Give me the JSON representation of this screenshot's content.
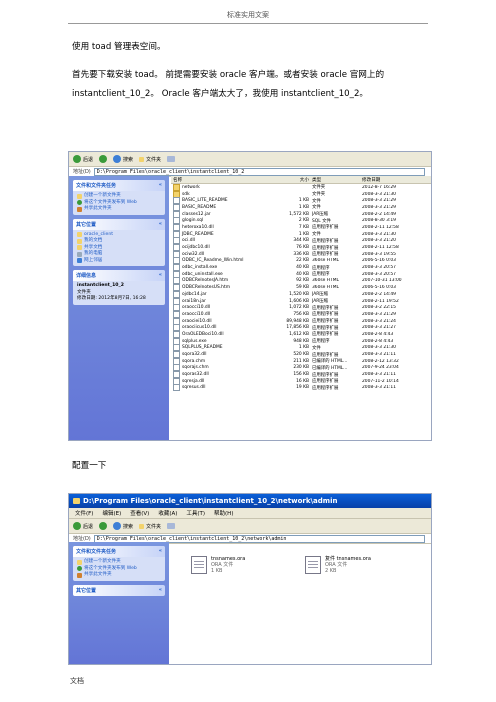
{
  "header": {
    "text": "标准实用文案"
  },
  "paragraphs": [
    "使用 toad 管理表空间。",
    "首先要下载安装 toad。 前提需要安装 oracle 客户端。或者安装 oracle 官网上的 instantclient_10_2。 Oracle 客户端太大了，我使用 instantclient_10_2。"
  ],
  "config_label": "配置一下",
  "footer": {
    "text": "文档"
  },
  "window1": {
    "toolbar": {
      "back": "后退",
      "search": "搜索",
      "folders": "文件夹"
    },
    "address_label": "地址(D)",
    "address": "D:\\Program Files\\oracle_client\\instantclient_10_2",
    "panel_tasks": {
      "title": "文件和文件夹任务",
      "items": [
        "创建一个新文件夹",
        "将这个文件夹发布到 Web",
        "共享此文件夹"
      ]
    },
    "panel_places": {
      "title": "其它位置",
      "items": [
        "oracle_client",
        "我的文档",
        "共享文档",
        "我的电脑",
        "网上邻居"
      ]
    },
    "panel_details": {
      "title": "详细信息",
      "name": "instantclient_10_2",
      "type": "文件夹",
      "modified": "修改日期: 2012年8月7日, 16:28"
    },
    "columns": [
      "名称",
      "大小",
      "类型",
      "修改日期"
    ],
    "files": [
      {
        "name": "network",
        "size": "",
        "type": "文件夹",
        "date": "2012-8-7 16:29",
        "folder": true
      },
      {
        "name": "sdk",
        "size": "",
        "type": "文件夹",
        "date": "2008-3-3 21:30",
        "folder": true
      },
      {
        "name": "BASIC_LITE_README",
        "size": "1 KB",
        "type": "文件",
        "date": "2008-3-3 21:29"
      },
      {
        "name": "BASIC_README",
        "size": "1 KB",
        "type": "文件",
        "date": "2008-3-3 21:29"
      },
      {
        "name": "classes12.jar",
        "size": "1,572 KB",
        "type": "JAR压缩",
        "date": "2008-2-2 14:49"
      },
      {
        "name": "glogin.sql",
        "size": "2 KB",
        "type": "SQL 文件",
        "date": "2008-8-30 3:19"
      },
      {
        "name": "heteroxa10.dll",
        "size": "7 KB",
        "type": "应用程序扩展",
        "date": "2008-2-11 12:58"
      },
      {
        "name": "JDBC_README",
        "size": "1 KB",
        "type": "文件",
        "date": "2008-3-3 21:30"
      },
      {
        "name": "oci.dll",
        "size": "344 KB",
        "type": "应用程序扩展",
        "date": "2008-3-3 21:20"
      },
      {
        "name": "ocijdbc10.dll",
        "size": "76 KB",
        "type": "应用程序扩展",
        "date": "2008-2-11 12:58"
      },
      {
        "name": "ociw32.dll",
        "size": "336 KB",
        "type": "应用程序扩展",
        "date": "2008-3-3 19:55"
      },
      {
        "name": "ODBC_IC_Readme_Win.html",
        "size": "22 KB",
        "type": "360se HTML",
        "date": "2006-5-16 0:03"
      },
      {
        "name": "odbc_install.exe",
        "size": "40 KB",
        "type": "应用程序",
        "date": "2008-3-3 20:57"
      },
      {
        "name": "odbc_uninstall.exe",
        "size": "40 KB",
        "type": "应用程序",
        "date": "2008-3-3 20:57"
      },
      {
        "name": "ODBCRelnotesJA.htm",
        "size": "92 KB",
        "type": "360se HTML",
        "date": "2007-10-31 13:00"
      },
      {
        "name": "ODBCRelnotesUS.htm",
        "size": "59 KB",
        "type": "360se HTML",
        "date": "2006-5-16 0:03"
      },
      {
        "name": "ojdbc14.jar",
        "size": "1,520 KB",
        "type": "JAR压缩",
        "date": "2008-2-2 14:49"
      },
      {
        "name": "orai18n.jar",
        "size": "1,606 KB",
        "type": "JAR压缩",
        "date": "2008-2-11 19:52"
      },
      {
        "name": "oraocci10.dll",
        "size": "1,072 KB",
        "type": "应用程序扩展",
        "date": "2008-3-2 22:15"
      },
      {
        "name": "oraocci10.dll",
        "size": "756 KB",
        "type": "应用程序扩展",
        "date": "2008-3-3 21:29"
      },
      {
        "name": "oraociei10.dll",
        "size": "89,948 KB",
        "type": "应用程序扩展",
        "date": "2008-3-3 21:24"
      },
      {
        "name": "oraociicus10.dll",
        "size": "17,856 KB",
        "type": "应用程序扩展",
        "date": "2008-3-3 21:27"
      },
      {
        "name": "OraOLEDBoci10.dll",
        "size": "1,612 KB",
        "type": "应用程序扩展",
        "date": "2008-2-8 4:43"
      },
      {
        "name": "sqlplus.exe",
        "size": "948 KB",
        "type": "应用程序",
        "date": "2008-2-8 4:43"
      },
      {
        "name": "SQLPLUS_README",
        "size": "1 KB",
        "type": "文件",
        "date": "2008-3-3 21:30"
      },
      {
        "name": "sqora32.dll",
        "size": "520 KB",
        "type": "应用程序扩展",
        "date": "2008-3-3 21:11"
      },
      {
        "name": "sqora.chm",
        "size": "211 KB",
        "type": "已编译的 HTML...",
        "date": "2008-2-12 13:32"
      },
      {
        "name": "sqorajs.chm",
        "size": "230 KB",
        "type": "已编译的 HTML...",
        "date": "2007-9-24 23:04"
      },
      {
        "name": "sqoras32.dll",
        "size": "156 KB",
        "type": "应用程序扩展",
        "date": "2008-3-3 21:11"
      },
      {
        "name": "sqresja.dll",
        "size": "16 KB",
        "type": "应用程序扩展",
        "date": "2007-11-2 10:14"
      },
      {
        "name": "sqresus.dll",
        "size": "19 KB",
        "type": "应用程序扩展",
        "date": "2008-3-3 21:11"
      }
    ]
  },
  "window2": {
    "title": "D:\\Program Files\\oracle_client\\instantclient_10_2\\network\\admin",
    "menu": [
      "文件(F)",
      "编辑(E)",
      "查看(V)",
      "收藏(A)",
      "工具(T)",
      "帮助(H)"
    ],
    "toolbar": {
      "back": "后退",
      "search": "搜索",
      "folders": "文件夹"
    },
    "address_label": "地址(D)",
    "address": "D:\\Program Files\\oracle_client\\instantclient_10_2\\network\\admin",
    "panel_tasks": {
      "title": "文件和文件夹任务",
      "items": [
        "创建一个新文件夹",
        "将这个文件夹发布到 Web",
        "共享此文件夹"
      ]
    },
    "panel_places": {
      "title": "其它位置"
    },
    "files": [
      {
        "name": "tnsnames.ora",
        "type": "ORA 文件",
        "size": "1 KB"
      },
      {
        "name": "复件 tnsnames.ora",
        "type": "ORA 文件",
        "size": "2 KB"
      }
    ]
  }
}
